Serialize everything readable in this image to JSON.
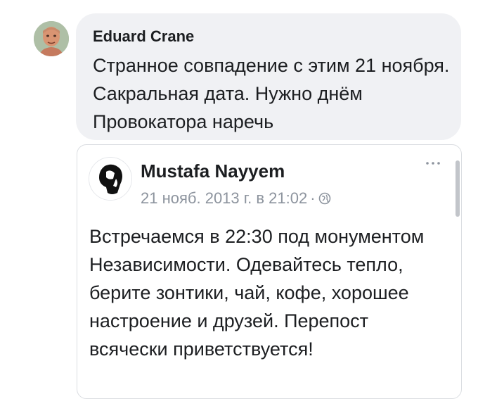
{
  "comment": {
    "author": "Eduard Crane",
    "text": "Странное совпадение с этим 21 ноября. Сакральная дата. Нужно днём Провокатора наречь"
  },
  "shared_post": {
    "author": "Mustafa Nayyem",
    "timestamp": "21 нояб. 2013 г. в 21:02",
    "separator": "·",
    "privacy_icon": "globe-icon",
    "more_icon": "more-horizontal-icon",
    "text": "Встречаемся в 22:30 под монументом Независимости. Одевайтесь тепло, берите зонтики, чай, кофе, хорошее настроение и друзей. Перепост всячески приветствуется!"
  },
  "colors": {
    "bubble_bg": "#f0f1f4",
    "text": "#1c1e21",
    "meta": "#8d949e",
    "border": "#dadde1"
  }
}
